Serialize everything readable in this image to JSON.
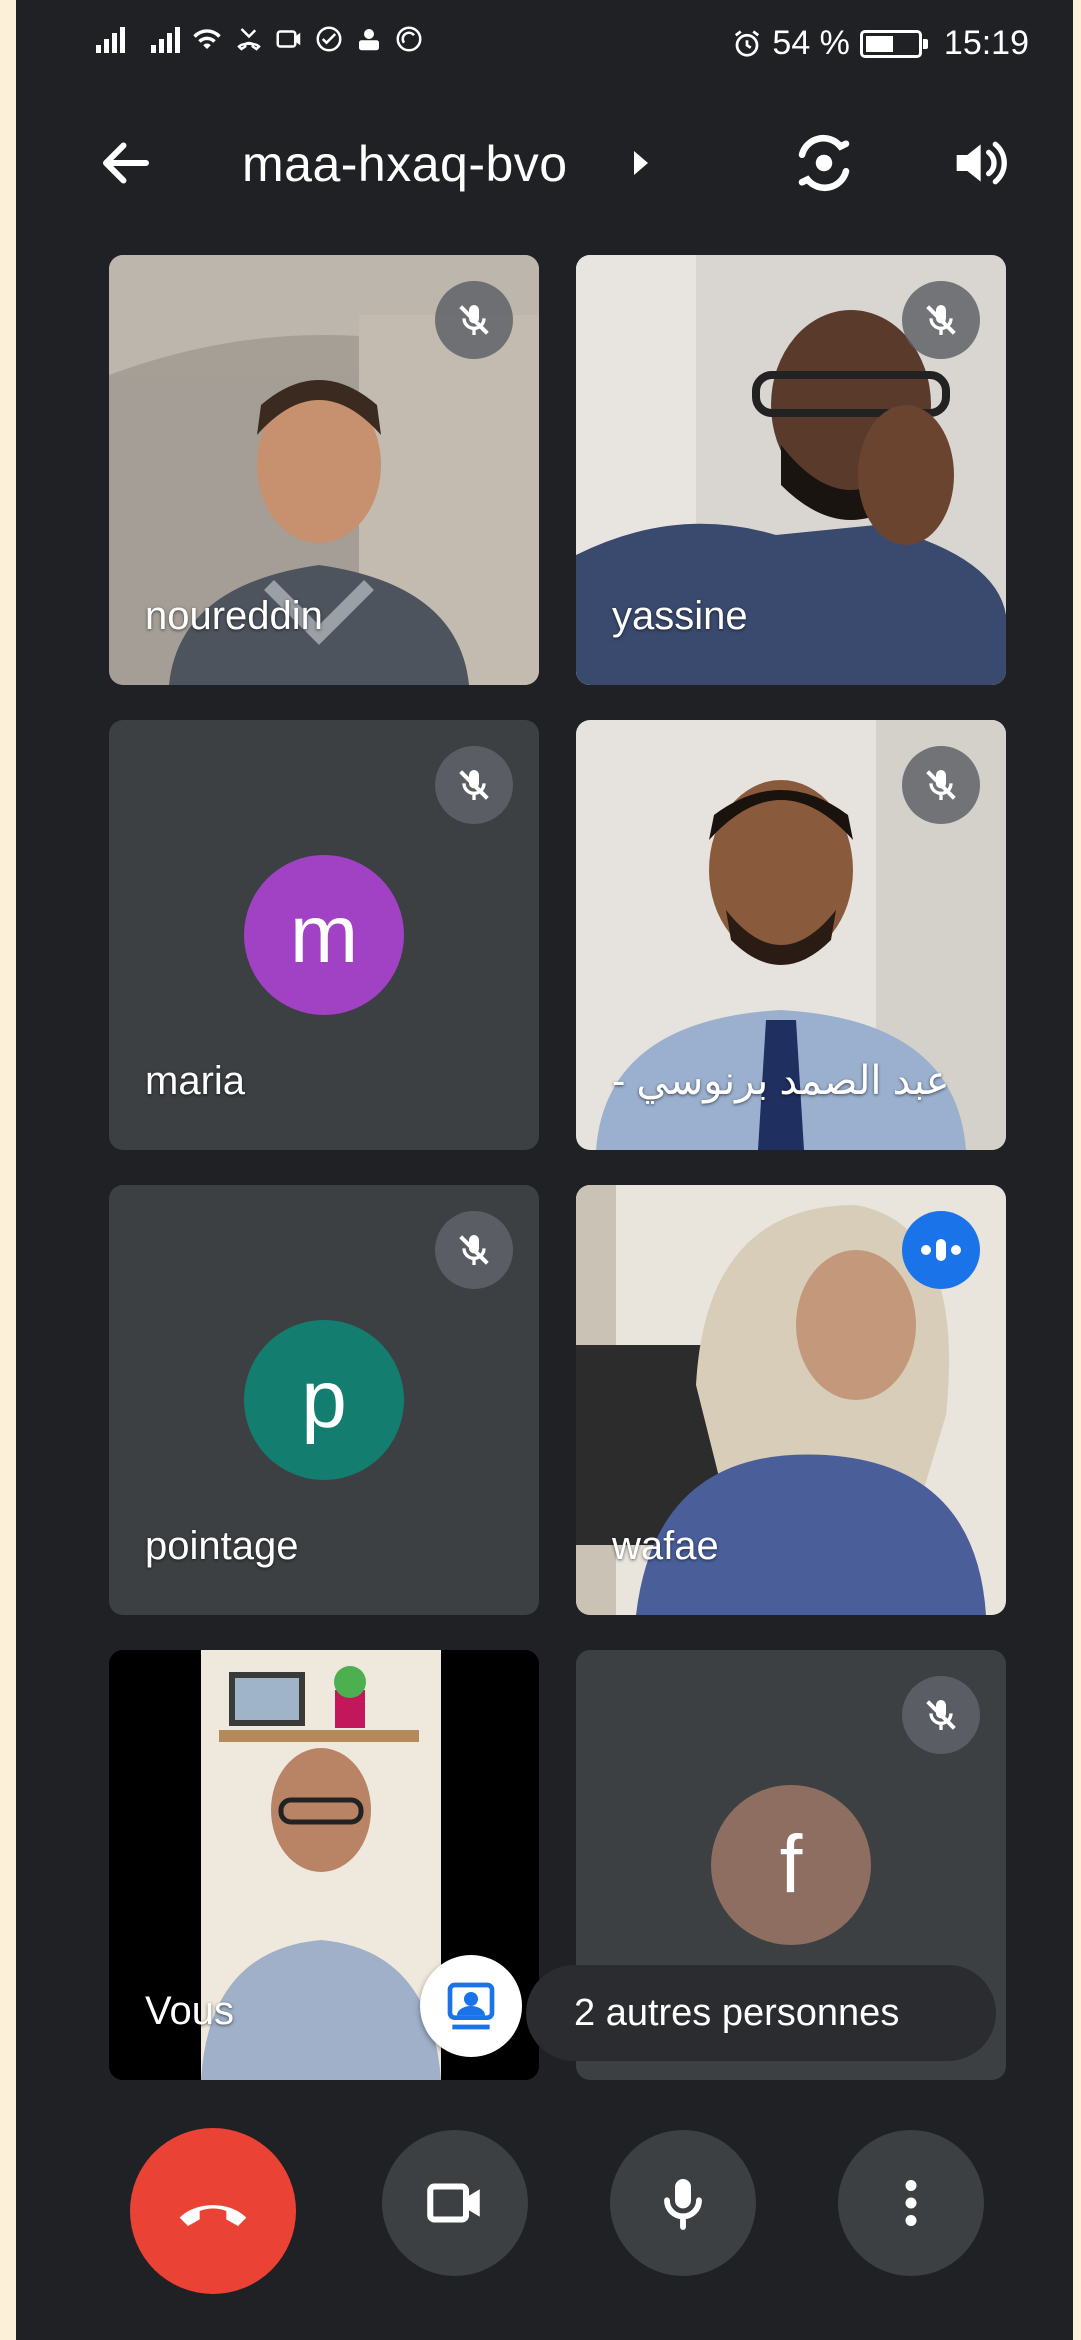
{
  "status_bar": {
    "battery_percent": "54 %",
    "battery_level": 0.54,
    "time": "15:19"
  },
  "header": {
    "meeting_code": "maa-hxaq-bvo",
    "icons": [
      "back-arrow-icon",
      "caret-right-icon",
      "switch-camera-icon",
      "speaker-icon"
    ]
  },
  "participants": [
    {
      "name": "noureddin",
      "video": true,
      "muted": true
    },
    {
      "name": "yassine",
      "video": true,
      "muted": true
    },
    {
      "name": "maria",
      "video": false,
      "initial": "m",
      "avatar_color": "#a142c4",
      "muted": true
    },
    {
      "name": "عبد الصمد برنوسي -",
      "video": true,
      "muted": true
    },
    {
      "name": "pointage",
      "video": false,
      "initial": "p",
      "avatar_color": "#137e6f",
      "muted": true
    },
    {
      "name": "wafae",
      "video": true,
      "muted": false,
      "speaking": true
    },
    {
      "name": "Vous",
      "video": true,
      "self": true
    },
    {
      "name": "f",
      "video": false,
      "initial": "f",
      "avatar_color": "#8e6e60",
      "muted": true
    }
  ],
  "others": {
    "label": "2 autres personnes"
  },
  "controls": {
    "icons": [
      "hang-up-icon",
      "camera-icon",
      "microphone-icon",
      "more-options-icon"
    ]
  },
  "colors": {
    "background": "#202124",
    "tile": "#3c4043",
    "hangup": "#ea4335",
    "speaking": "#1a73e8"
  }
}
